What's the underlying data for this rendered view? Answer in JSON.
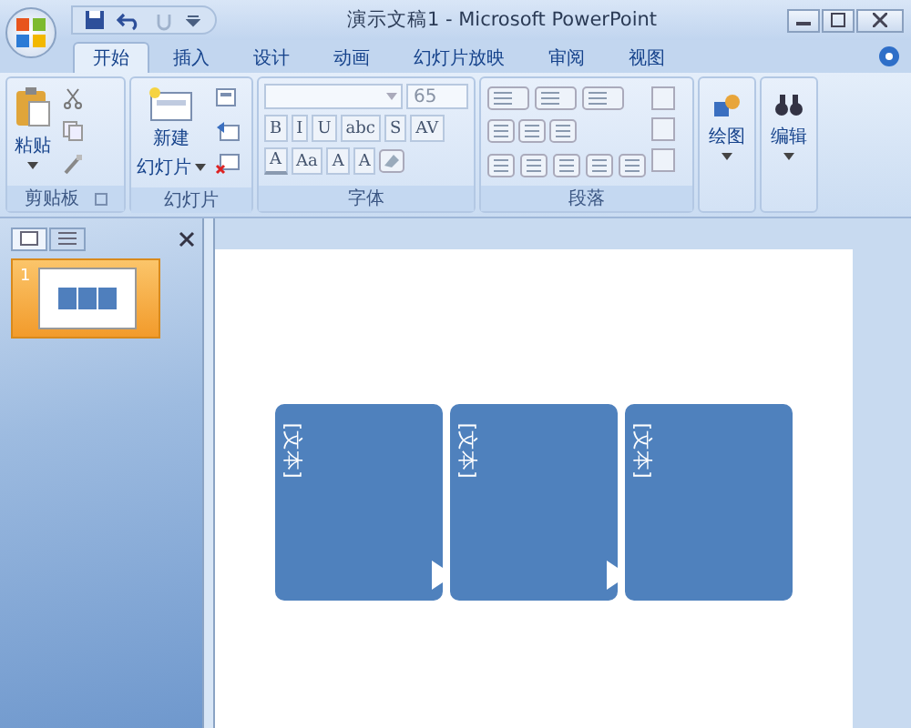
{
  "window": {
    "title": "演示文稿1 - Microsoft PowerPoint"
  },
  "tabs": [
    {
      "label": "开始",
      "selected": true
    },
    {
      "label": "插入",
      "selected": false
    },
    {
      "label": "设计",
      "selected": false
    },
    {
      "label": "动画",
      "selected": false
    },
    {
      "label": "幻灯片放映",
      "selected": false
    },
    {
      "label": "审阅",
      "selected": false
    },
    {
      "label": "视图",
      "selected": false
    }
  ],
  "ribbon": {
    "groups": [
      {
        "kind": "clipboard",
        "label": "剪贴板",
        "button": "粘贴"
      },
      {
        "kind": "slides",
        "label": "幻灯片",
        "button": "新建",
        "button_line2": "幻灯片"
      },
      {
        "kind": "font",
        "label": "字体",
        "font_size": "65",
        "format_buttons": [
          "B",
          "I",
          "U",
          "abc",
          "S",
          "AV"
        ],
        "size_buttons": [
          "A",
          "Aa",
          "A",
          "A"
        ]
      },
      {
        "kind": "paragraph",
        "label": "段落"
      },
      {
        "kind": "drawing",
        "button": "绘图"
      },
      {
        "kind": "editing",
        "button": "编辑"
      }
    ]
  },
  "thumbnails": [
    {
      "number": "1",
      "selected": true
    }
  ],
  "slide": {
    "boxes": [
      {
        "text": "[文本]"
      },
      {
        "text": "[文本]"
      },
      {
        "text": "[文本]"
      }
    ]
  }
}
